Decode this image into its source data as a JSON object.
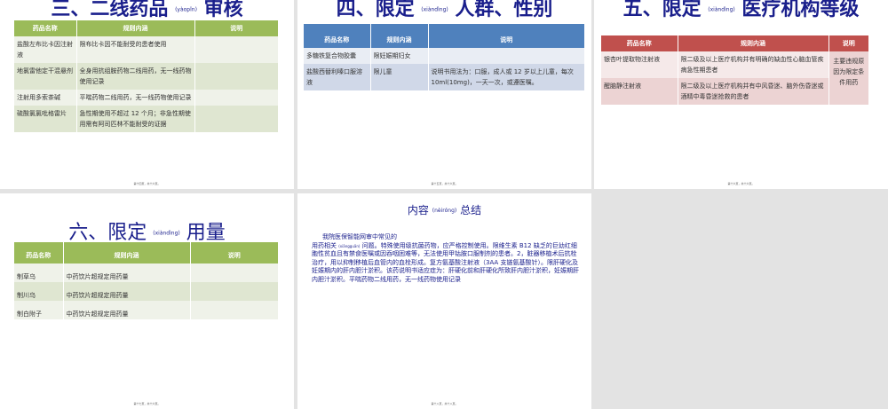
{
  "slides": [
    {
      "title": "三、二线药品",
      "pinyin": "(yàopǐn)",
      "title_end": "审核",
      "headers": [
        "药品名称",
        "规则内涵",
        "说明"
      ],
      "rows": [
        [
          "盐酸左布比卡因注射液",
          "限布比卡因不能耐受的患者使用",
          ""
        ],
        [
          "地氯雷他定干混悬剂",
          "全身用抗组胺药物二线用药，无一线药物使用记录",
          ""
        ],
        [
          "注射用多索茶碱",
          "平喘药物二线用药，无一线药物使用记录",
          ""
        ],
        [
          "硫酸氯氯吡格雷片",
          "急性期使用不超过 12 个月；非急性期使用需有阿司匹林不能耐受的证据",
          ""
        ]
      ],
      "footer": "第十四页，共十六页。"
    },
    {
      "title": "四、限定",
      "pinyin": "(xiàndìng)",
      "title_end": "人群、性别",
      "headers": [
        "药品名称",
        "规则内涵",
        "说明"
      ],
      "rows": [
        [
          "多糖铁复合物胶囊",
          "限妊娠期妇女",
          ""
        ],
        [
          "盐酸西替利嗪口服溶液",
          "限儿童",
          "说明书用法为：口服，成人或 12 岁以上儿童，每次 10ml(10mg)，一天一次，或遵医嘱。"
        ]
      ],
      "footer": "第十五页，共十六页。"
    },
    {
      "title": "五、限定",
      "pinyin": "(xiàndìng)",
      "title_end": "医疗机构等级",
      "headers": [
        "药品名称",
        "规则内涵",
        "说明"
      ],
      "rows": [
        [
          "银杏叶提取物注射液",
          "限二级及以上医疗机构并有明确的缺血性心脑血管疾病急性期患者"
        ],
        [
          "醒脑静注射液",
          "限二级及以上医疗机构并有中风昏迷、脑外伤昏迷或酒精中毒昏迷抢救的患者"
        ]
      ],
      "note": "主要违规原因为限定条件用药",
      "footer": "第十六页，共十六页。"
    },
    {
      "title": "六、限定",
      "pinyin": "(xiàndìng)",
      "title_end": "用量",
      "headers": [
        "药品名称",
        "规则内涵",
        "说明"
      ],
      "rows": [
        [
          "制草乌",
          "中药饮片超规定用药量",
          ""
        ],
        [
          "制川乌",
          "中药饮片超规定用药量",
          ""
        ],
        [
          "制白附子",
          "中药饮片超规定用药量",
          ""
        ]
      ],
      "footer": "第十七页，共十六页。"
    },
    {
      "title": "内容",
      "pinyin": "(nèiróng)",
      "title_end": "总结",
      "line1": "我院医保智能网审中常见的",
      "line2a": "用药相关",
      "pinyin2": "(xiāngguān)",
      "line2b": "问题。特殊使用级抗菌药物，应严格控制使用。限维生素 B12 缺乏的巨幼红细胞性贫血且有禁食医嘱或因吞咽困难等，无法使用甲钴胺口服制剂的患者。2，脏器移植术后抗栓治疗，用以抑制移植后血管内的血栓形成。复方氨基酸注射液（3AA 支链氨基酸针）。限肝硬化及妊娠期内的肝内胆汁淤积。该药说明书适应症为：肝硬化前和肝硬化所致肝内胆汁淤积，妊娠期肝内胆汁淤积。平喘药物二线用药，无一线药物使用记录",
      "footer": "第十八页，共十八页。"
    }
  ]
}
